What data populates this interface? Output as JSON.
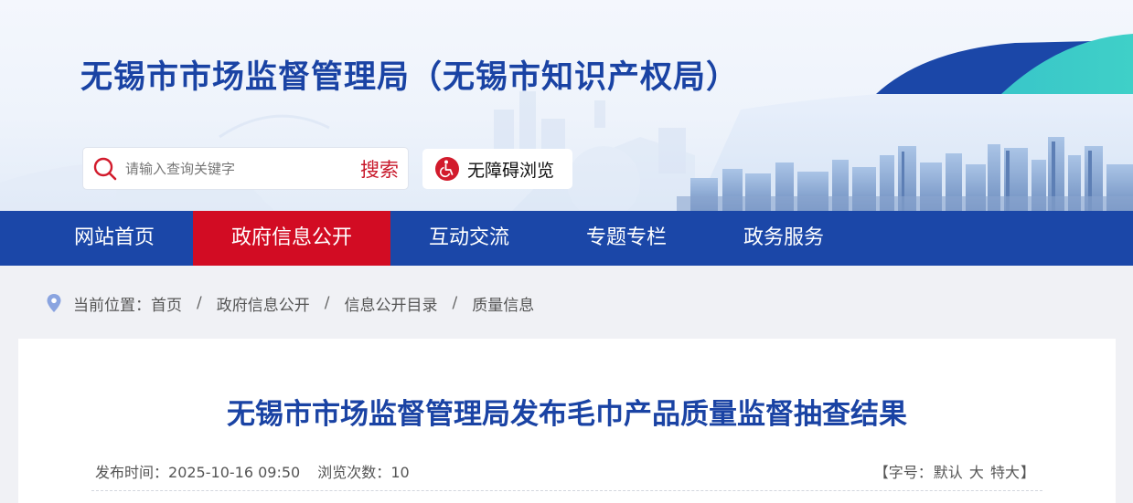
{
  "site": {
    "title": "无锡市市场监督管理局（无锡市知识产权局）"
  },
  "search": {
    "placeholder": "请输入查询关键字",
    "value": "",
    "button_label": "搜索"
  },
  "accessibility": {
    "label": "无障碍浏览"
  },
  "nav": {
    "items": [
      {
        "label": "网站首页",
        "active": false
      },
      {
        "label": "政府信息公开",
        "active": true
      },
      {
        "label": "互动交流",
        "active": false
      },
      {
        "label": "专题专栏",
        "active": false
      },
      {
        "label": "政务服务",
        "active": false
      }
    ]
  },
  "breadcrumb": {
    "prefix": "当前位置：",
    "items": [
      "首页",
      "政府信息公开",
      "信息公开目录",
      "质量信息"
    ],
    "separator": "/"
  },
  "article": {
    "title": "无锡市市场监督管理局发布毛巾产品质量监督抽查结果",
    "publish_label": "发布时间：",
    "publish_time": "2025-10-16 09:50",
    "views_label": "浏览次数：",
    "views": "10"
  },
  "font_size": {
    "open_bracket": "【",
    "label": "字号：",
    "options": [
      "默认",
      "大",
      "特大"
    ],
    "close_bracket": "】"
  },
  "colors": {
    "brand_blue": "#1b47a8",
    "title_blue": "#1a43a4",
    "active_red": "#d20c23",
    "search_red": "#c8182a",
    "page_bg": "#f0f1f5"
  }
}
